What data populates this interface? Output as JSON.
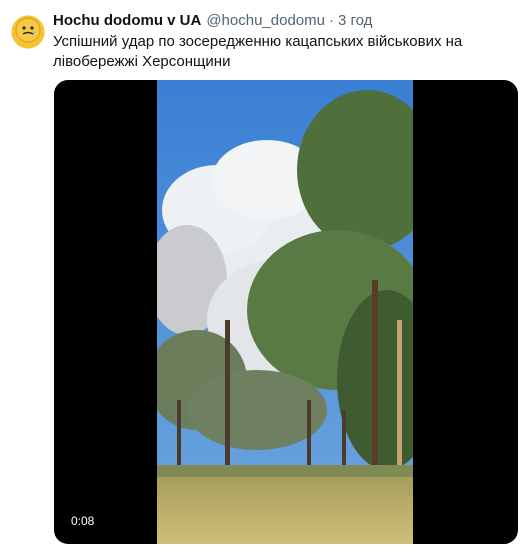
{
  "tweet": {
    "author_name": "Hochu dodomu v UA",
    "handle": "@hochu_dodomu",
    "separator": "·",
    "time": "3 год",
    "text": "Успішний удар по зосередженню кацапських військових на лівобережжі Херсонщини"
  },
  "media": {
    "duration": "0:08",
    "colors": {
      "sky": "#3f86d8",
      "smoke": "#e7ebef",
      "trees": "#4e6b3a",
      "grass": "#b8ad6a"
    }
  }
}
